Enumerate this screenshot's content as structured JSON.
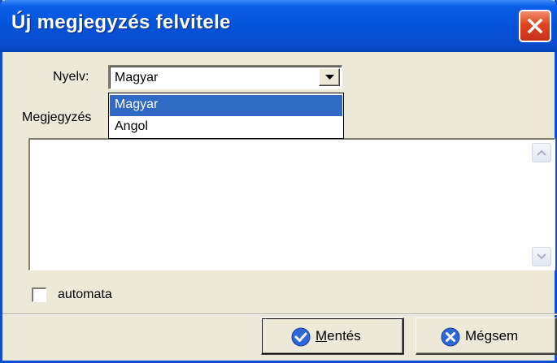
{
  "window": {
    "title": "Új megjegyzés felvitele"
  },
  "language": {
    "label": "Nyelv:",
    "selected": "Magyar",
    "options": [
      "Magyar",
      "Angol"
    ]
  },
  "note": {
    "label": "Megjegyzés",
    "value": ""
  },
  "automata": {
    "label": "automata",
    "checked": false
  },
  "buttons": {
    "save": "Mentés",
    "cancel": "Mégsem"
  },
  "colors": {
    "titlebar": "#0553d8",
    "selection": "#316ac5",
    "dialog_bg": "#ece9d8",
    "close": "#e0441e",
    "button_icon": "#2f66d9"
  },
  "icons": {
    "close": "close-icon",
    "dropdown": "chevron-down-icon",
    "save": "checkmark-icon",
    "cancel": "x-circle-icon"
  }
}
